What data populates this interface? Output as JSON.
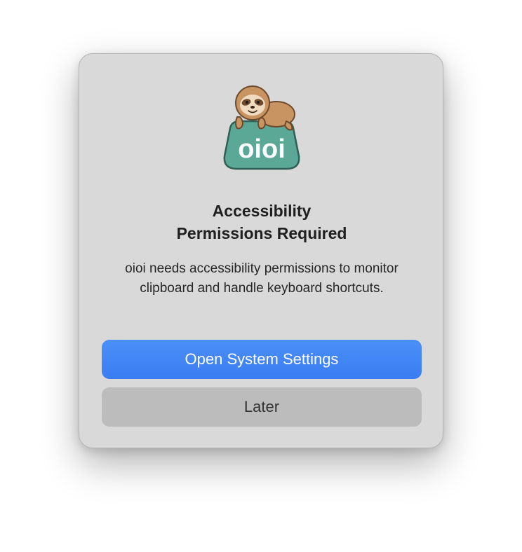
{
  "dialog": {
    "icon": "oioi-sloth-app-icon",
    "icon_text": "oioi",
    "title_line1": "Accessibility",
    "title_line2": "Permissions Required",
    "message": "oioi needs accessibility permissions to monitor clipboard and handle keyboard shortcuts.",
    "primary_button": "Open System Settings",
    "secondary_button": "Later"
  },
  "colors": {
    "dialog_background": "#d9d9d9",
    "primary_button": "#3b82f6",
    "secondary_button": "#bcbcbc",
    "icon_teal": "#5aa895",
    "sloth_brown": "#c89462"
  }
}
